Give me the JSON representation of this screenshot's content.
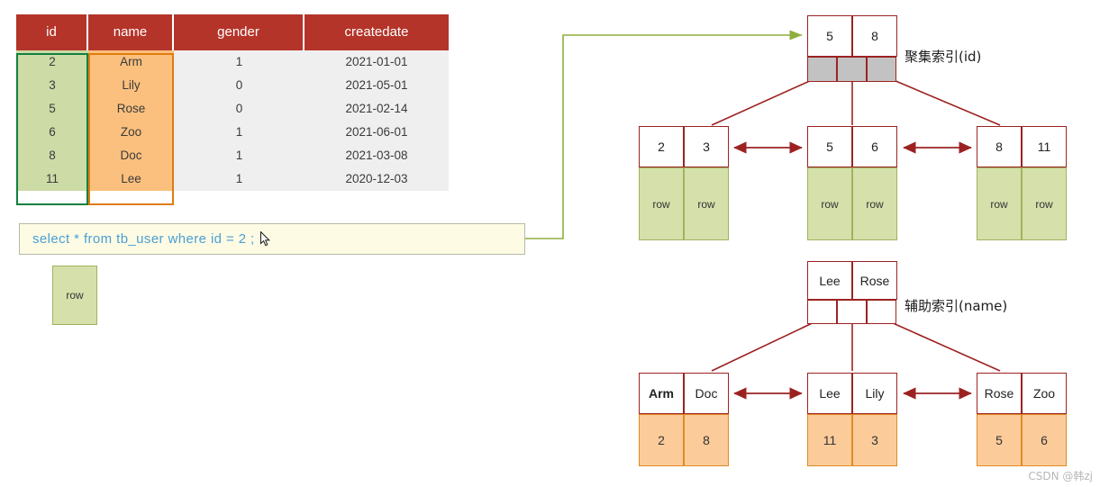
{
  "table": {
    "columns": [
      "id",
      "name",
      "gender",
      "createdate"
    ],
    "rows": [
      {
        "id": "2",
        "name": "Arm",
        "gender": "1",
        "createdate": "2021-01-01"
      },
      {
        "id": "3",
        "name": "Lily",
        "gender": "0",
        "createdate": "2021-05-01"
      },
      {
        "id": "5",
        "name": "Rose",
        "gender": "0",
        "createdate": "2021-02-14"
      },
      {
        "id": "6",
        "name": "Zoo",
        "gender": "1",
        "createdate": "2021-06-01"
      },
      {
        "id": "8",
        "name": "Doc",
        "gender": "1",
        "createdate": "2021-03-08"
      },
      {
        "id": "11",
        "name": "Lee",
        "gender": "1",
        "createdate": "2020-12-03"
      }
    ],
    "highlight_id_color": "#128040",
    "highlight_name_color": "#e07c10",
    "header_color": "#b4342a",
    "id_cell_color": "#cddba6",
    "name_cell_color": "#fbc07e"
  },
  "sql": {
    "query": "select * from tb_user where id = 2 ;",
    "text_color": "#4b9fd5",
    "background": "#fdfbe4"
  },
  "result_row": {
    "label": "row"
  },
  "clustered_index": {
    "label": "聚集索引(id)",
    "root": {
      "keys": [
        "5",
        "8"
      ],
      "pointers": 3
    },
    "leaves": [
      {
        "keys": [
          "2",
          "3"
        ],
        "payload": [
          "row",
          "row"
        ]
      },
      {
        "keys": [
          "5",
          "6"
        ],
        "payload": [
          "row",
          "row"
        ]
      },
      {
        "keys": [
          "8",
          "11"
        ],
        "payload": [
          "row",
          "row"
        ]
      }
    ]
  },
  "secondary_index": {
    "label": "辅助索引(name)",
    "root": {
      "keys": [
        "Lee",
        "Rose"
      ],
      "pointers": 3
    },
    "leaves": [
      {
        "keys": [
          "Arm",
          "Doc"
        ],
        "payload": [
          "2",
          "8"
        ],
        "bold": [
          true,
          false
        ]
      },
      {
        "keys": [
          "Lee",
          "Lily"
        ],
        "payload": [
          "11",
          "3"
        ],
        "bold": [
          false,
          false
        ]
      },
      {
        "keys": [
          "Rose",
          "Zoo"
        ],
        "payload": [
          "5",
          "6"
        ],
        "bold": [
          false,
          false
        ]
      }
    ]
  },
  "watermark": {
    "text": "CSDN @韩zj"
  },
  "colors": {
    "node_border": "#9c2222",
    "arrow": "#9c2222",
    "query_arrow": "#8fae3e",
    "pointer_gray": "#c2c2c2"
  }
}
